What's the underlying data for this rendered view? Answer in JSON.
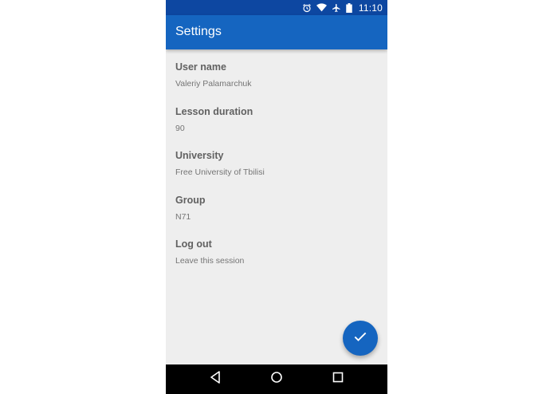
{
  "status_bar": {
    "time": "11:10",
    "icons": [
      "alarm-icon",
      "wifi-icon",
      "airplane-icon",
      "battery-icon"
    ]
  },
  "app_bar": {
    "title": "Settings"
  },
  "settings": [
    {
      "title": "User name",
      "summary": "Valeriy Palamarchuk"
    },
    {
      "title": "Lesson duration",
      "summary": "90"
    },
    {
      "title": "University",
      "summary": "Free University of Tbilisi"
    },
    {
      "title": "Group",
      "summary": "N71"
    },
    {
      "title": "Log out",
      "summary": "Leave this session"
    }
  ],
  "fab": {
    "icon": "check-icon"
  },
  "nav_bar": {
    "icons": [
      "back-icon",
      "home-icon",
      "recents-icon"
    ]
  },
  "colors": {
    "status_bar": "#0d47a1",
    "app_bar": "#1565c0",
    "background": "#eeeeee",
    "fab": "#1565c0"
  }
}
